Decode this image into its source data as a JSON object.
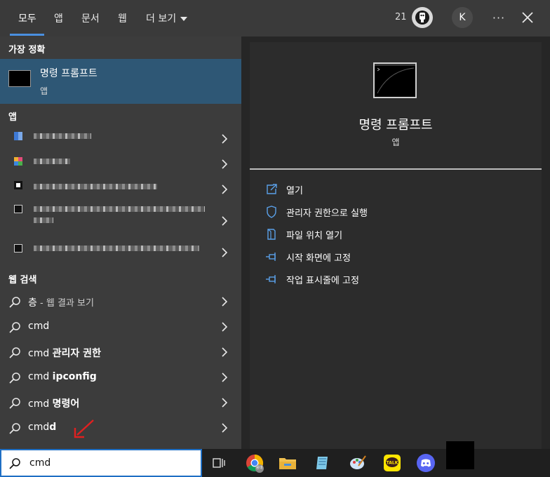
{
  "tabs": [
    {
      "label": "모두"
    },
    {
      "label": "앱"
    },
    {
      "label": "문서"
    },
    {
      "label": "웹"
    },
    {
      "label": "더 보기"
    }
  ],
  "header": {
    "points": "21",
    "avatar_letter": "K",
    "more_label": "···"
  },
  "sections": {
    "best_match": "가장 정확",
    "apps": "앱",
    "web": "웹 검색"
  },
  "best_match": {
    "title": "명령 프롬프트",
    "subtitle": "앱"
  },
  "web_results": [
    {
      "prefix": "층",
      "bold": "",
      "suffix": " - 웹 결과 보기"
    },
    {
      "prefix": "cmd",
      "bold": "",
      "suffix": ""
    },
    {
      "prefix": "cmd ",
      "bold": "관리자 권한",
      "suffix": ""
    },
    {
      "prefix": "cmd ",
      "bold": "ipconfig",
      "suffix": ""
    },
    {
      "prefix": "cmd ",
      "bold": "명령어",
      "suffix": ""
    },
    {
      "prefix": "cmd",
      "bold": "d",
      "suffix": ""
    }
  ],
  "preview": {
    "title": "명령 프롬프트",
    "subtitle": "앱"
  },
  "actions": [
    {
      "label": "열기",
      "icon": "open-icon"
    },
    {
      "label": "관리자 권한으로 실행",
      "icon": "shield-icon"
    },
    {
      "label": "파일 위치 열기",
      "icon": "file-location-icon"
    },
    {
      "label": "시작 화면에 고정",
      "icon": "pin-icon"
    },
    {
      "label": "작업 표시줄에 고정",
      "icon": "pin-icon"
    }
  ],
  "search": {
    "query": "cmd"
  },
  "taskbar": {
    "chrome_badge": "용대"
  },
  "colors": {
    "accent": "#4a8fe0",
    "selected": "#2e5775",
    "panel_left": "#3c3c3c",
    "panel_right": "#2c2c2c"
  }
}
